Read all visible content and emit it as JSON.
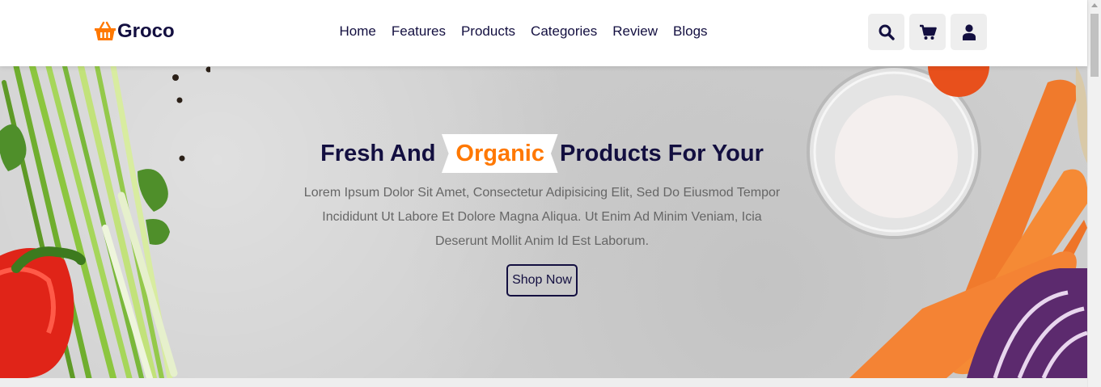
{
  "header": {
    "logo_text": "Groco",
    "nav": [
      "Home",
      "Features",
      "Products",
      "Categories",
      "Review",
      "Blogs"
    ],
    "icons": [
      "search-icon",
      "cart-icon",
      "user-icon"
    ]
  },
  "hero": {
    "title_before": "Fresh And",
    "title_highlight": "Organic",
    "title_after": "Products For Your",
    "text": "Lorem Ipsum Dolor Sit Amet, Consectetur Adipisicing Elit, Sed Do Eiusmod Tempor Incididunt Ut Labore Et Dolore Magna Aliqua. Ut Enim Ad Minim Veniam, Icia Deserunt Mollit Anim Id Est Laborum.",
    "button_label": "Shop Now"
  },
  "colors": {
    "accent": "#ff7800",
    "brand_dark": "#130f40",
    "text_muted": "#666666",
    "light_bg": "#eeeeee"
  }
}
